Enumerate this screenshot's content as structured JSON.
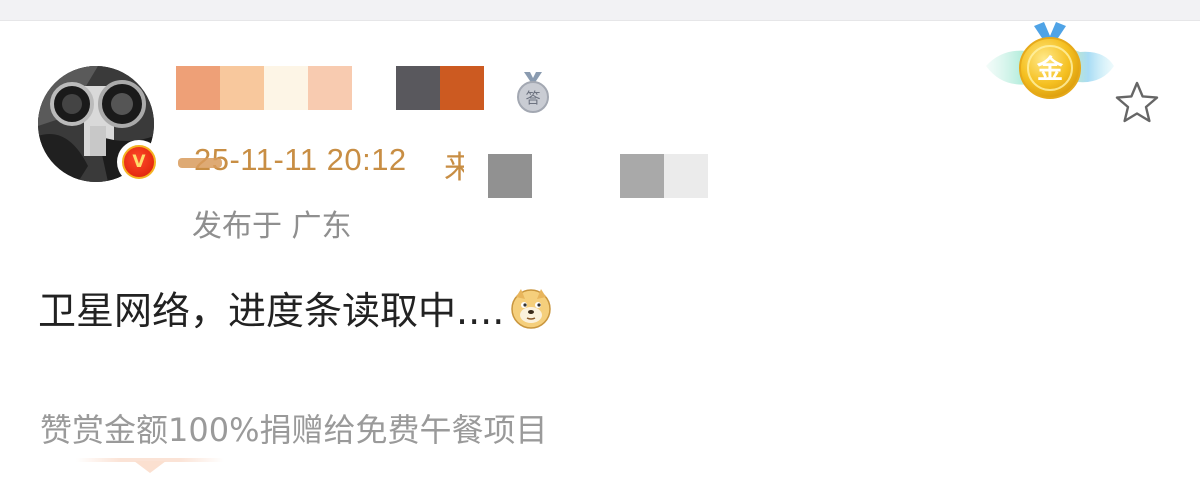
{
  "post": {
    "timestamp": "25-11-11 20:12",
    "source_prefix": "来",
    "location": "发布于 广东",
    "text": "卫星网络，进度条读取中....",
    "emoji_name": "doge-emoji",
    "reward_note": "赞赏金额100%捐赠给免费午餐项目"
  },
  "author": {
    "verified_badge_letter": "V",
    "medal_small_char": "答"
  },
  "gold_badge": {
    "char": "金"
  },
  "colors": {
    "timestamp": "#c88e44",
    "location": "#8f8f8f",
    "post_text": "#222222",
    "reward_text": "#9a9a9a",
    "verified_red": "#e42a10",
    "gold": "#f5c021"
  },
  "username_mosaic_colors": [
    "#eea077",
    "#f8c89d",
    "#fdf5e6",
    "#f8cbb0",
    "#ffffff",
    "#59585d",
    "#cc5a21"
  ],
  "source_mosaic_colors": [
    "#919191",
    "#ffffff",
    "#ffffff",
    "#a9a9a9",
    "#ebebeb"
  ],
  "icons": [
    "verified-icon",
    "medal-icon",
    "gold-medal-icon",
    "star-icon",
    "doge-emoji"
  ]
}
